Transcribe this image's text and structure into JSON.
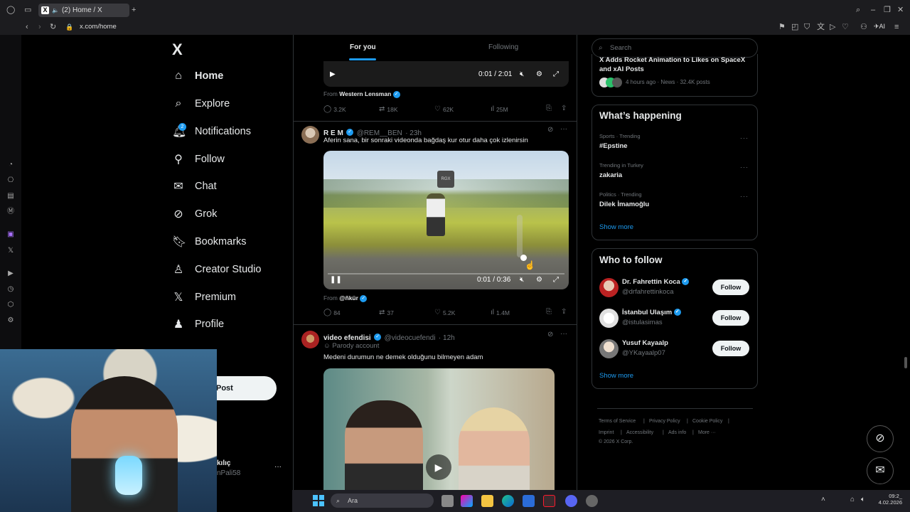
{
  "browser": {
    "tab_title": "(2) Home / X",
    "url": "x.com/home",
    "ai_label": "AI"
  },
  "nav": {
    "logo": "X",
    "items": [
      {
        "label": "Home",
        "icon": "home-icon"
      },
      {
        "label": "Explore",
        "icon": "search-icon"
      },
      {
        "label": "Notifications",
        "icon": "bell-icon"
      },
      {
        "label": "Follow",
        "icon": "person-add-icon"
      },
      {
        "label": "Chat",
        "icon": "envelope-icon"
      },
      {
        "label": "Grok",
        "icon": "grok-icon"
      },
      {
        "label": "Bookmarks",
        "icon": "bookmark-icon"
      },
      {
        "label": "Creator Studio",
        "icon": "creator-icon"
      },
      {
        "label": "Premium",
        "icon": "x-icon"
      },
      {
        "label": "Profile",
        "icon": "person-icon"
      }
    ],
    "notifications_badge": "2",
    "post_button": "Post",
    "account_name": "kılıç",
    "account_handle": "nPali58"
  },
  "timeline": {
    "tabs": [
      "For you",
      "Following"
    ],
    "tweet1": {
      "video_time": "0:01 / 2:01",
      "from_label": "From",
      "from_name": "Western Lensman",
      "replies": "3.2K",
      "reposts": "18K",
      "likes": "62K",
      "views": "25M"
    },
    "tweet2": {
      "name": "R E M",
      "handle": "@REM__BEN",
      "time": "· 23h",
      "text": "Aferin sana, bir sonraki videonda bağdaş kur otur daha çok izlenirsin",
      "video_time": "0:01 / 0:36",
      "video_watermark": "RGX",
      "from_label": "From",
      "from_name": "@ñkür",
      "replies": "84",
      "reposts": "37",
      "likes": "5.2K",
      "views": "1.4M"
    },
    "tweet3": {
      "name": "video efendisi",
      "handle": "@videocuefendi",
      "time": "· 12h",
      "parody": "Parody account",
      "text": "Medeni durumun ne demek olduğunu bilmeyen adam"
    }
  },
  "right": {
    "search_placeholder": "Search",
    "news": {
      "title": "X Adds Rocket Animation to Likes on SpaceX and xAI Posts",
      "meta": "4 hours ago · News · 32.4K posts"
    },
    "happening": {
      "title": "What’s happening",
      "trends": [
        {
          "meta": "Sports · Trending",
          "name": "#Epstine"
        },
        {
          "meta": "Trending in Turkey",
          "name": "zakaria"
        },
        {
          "meta": "Politics · Trending",
          "name": "Dilek İmamoğlu"
        }
      ],
      "show_more": "Show more"
    },
    "who_to_follow": {
      "title": "Who to follow",
      "users": [
        {
          "name": "Dr. Fahrettin Koca",
          "handle": "@drfahrettinkoca",
          "button": "Follow"
        },
        {
          "name": "İstanbul Ulaşım",
          "handle": "@istulasimas",
          "button": "Follow"
        },
        {
          "name": "Yusuf Kayaalp",
          "handle": "@YKayaalp07",
          "button": "Follow"
        }
      ],
      "show_more": "Show more"
    },
    "footer": {
      "links": [
        "Terms of Service",
        "Privacy Policy",
        "Cookie Policy",
        "Imprint",
        "Accessibility",
        "Ads info",
        "More ···"
      ],
      "copyright": "© 2026 X Corp."
    }
  },
  "taskbar": {
    "search_label": "Ara",
    "time": "09:2_",
    "date": "4.02.2026"
  },
  "colors": {
    "accent": "#1d9bf0",
    "background": "#000000",
    "border": "#2f3336",
    "muted": "#71767b"
  }
}
